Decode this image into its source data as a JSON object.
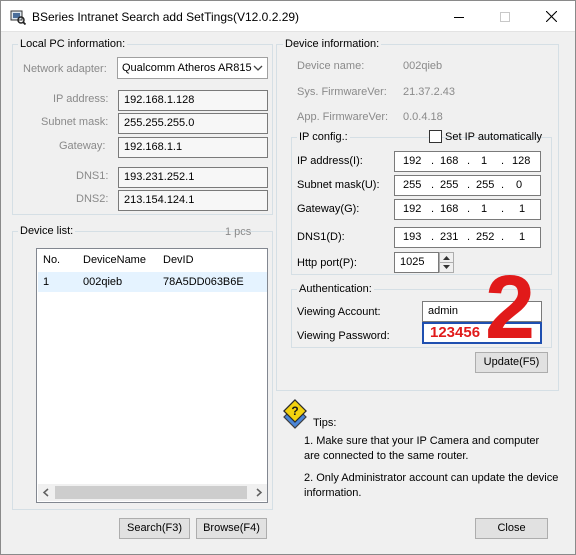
{
  "window": {
    "title": "BSeries Intranet Search add  SetTings(V12.0.2.29)",
    "icons": {
      "app": "app-icon",
      "minimize": "minimize-icon",
      "maximize": "maximize-icon",
      "close": "close-icon"
    }
  },
  "local_pc": {
    "group_title": "Local PC information:",
    "network_adapter_label": "Network adapter:",
    "network_adapter_value": "Qualcomm Atheros AR815",
    "ip_label": "IP address:",
    "ip_value": "192.168.1.128",
    "subnet_label": "Subnet mask:",
    "subnet_value": "255.255.255.0",
    "gateway_label": "Gateway:",
    "gateway_value": "192.168.1.1",
    "dns1_label": "DNS1:",
    "dns1_value": "193.231.252.1",
    "dns2_label": "DNS2:",
    "dns2_value": "213.154.124.1"
  },
  "device_list": {
    "group_title": "Device list:",
    "count": "1 pcs",
    "columns": [
      "No.",
      "DeviceName",
      "DevID"
    ],
    "rows": [
      [
        "1",
        "002qieb",
        "78A5DD063B6E"
      ]
    ]
  },
  "buttons": {
    "search": "Search(F3)",
    "browse": "Browse(F4)",
    "update": "Update(F5)",
    "close": "Close"
  },
  "device_info": {
    "group_title": "Device information:",
    "name_label": "Device name:",
    "name_value": "002qieb",
    "sys_fw_label": "Sys. FirmwareVer:",
    "sys_fw_value": "21.37.2.43",
    "app_fw_label": "App. FirmwareVer:",
    "app_fw_value": "0.0.4.18"
  },
  "ip_config": {
    "group_title": "IP config.:",
    "auto_label": "Set IP automatically",
    "auto_checked": false,
    "ip_label": "IP address(I):",
    "ip": [
      "192",
      "168",
      "1",
      "128"
    ],
    "subnet_label": "Subnet mask(U):",
    "subnet": [
      "255",
      "255",
      "255",
      "0"
    ],
    "gateway_label": "Gateway(G):",
    "gateway": [
      "192",
      "168",
      "1",
      "1"
    ],
    "dns1_label": "DNS1(D):",
    "dns1": [
      "193",
      "231",
      "252",
      "1"
    ],
    "port_label": "Http port(P):",
    "port_value": "1025"
  },
  "auth": {
    "group_title": "Authentication:",
    "account_label": "Viewing Account:",
    "account_value": "admin",
    "password_label": "Viewing Password:",
    "password_value": "123456"
  },
  "annotation": {
    "number": "2",
    "color": "#e11a1a"
  },
  "tips": {
    "title": "Tips:",
    "line1": "1. Make sure  that your IP Camera and computer are connected to the same router.",
    "line2": "2. Only Administrator account can update the device information."
  }
}
